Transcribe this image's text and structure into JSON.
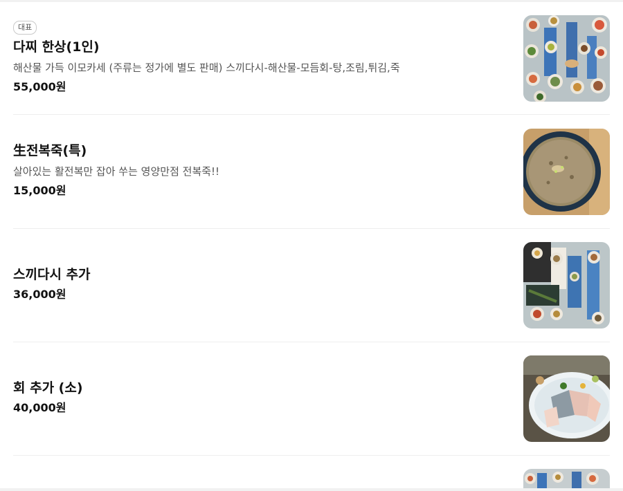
{
  "menu": {
    "items": [
      {
        "badge": "대표",
        "name": "다찌 한상(1인)",
        "description": "해산물 가득 이모카세 (주류는 정가에 별도 판매) 스끼다시-해산물-모듬회-탕,조림,튀김,죽",
        "price": "55,000원",
        "image": "seafood-spread-photo"
      },
      {
        "name": "生전복죽(특)",
        "description": "살아있는 활전복만 잡아 쑤는 영양만점 전복죽!!",
        "price": "15,000원",
        "image": "abalone-porridge-photo"
      },
      {
        "name": "스끼다시 추가",
        "price": "36,000원",
        "image": "side-dishes-photo"
      },
      {
        "name": "회 추가 (소)",
        "price": "40,000원",
        "image": "sashimi-platter-photo"
      }
    ],
    "partial_next_item_image": "next-item-photo"
  }
}
